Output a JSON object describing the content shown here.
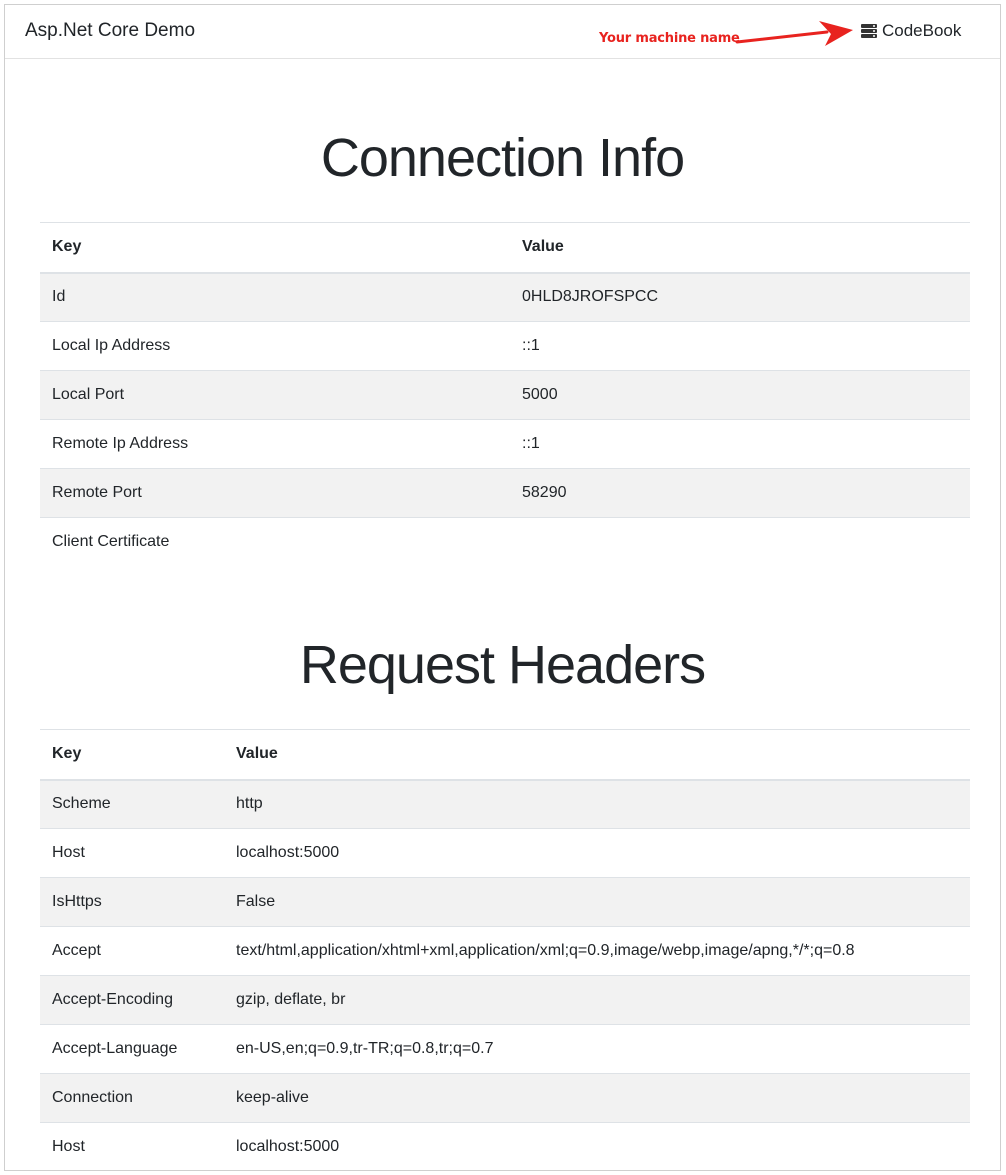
{
  "navbar": {
    "brand": "Asp.Net Core Demo",
    "machine_name": "CodeBook",
    "machine_icon": "server-icon",
    "annotation": "Your machine name",
    "annotation_color": "#e8231f"
  },
  "connection_info": {
    "title": "Connection Info",
    "columns": [
      "Key",
      "Value"
    ],
    "rows": [
      {
        "key": "Id",
        "value": "0HLD8JROFSPCC"
      },
      {
        "key": "Local Ip Address",
        "value": "::1"
      },
      {
        "key": "Local Port",
        "value": "5000"
      },
      {
        "key": "Remote Ip Address",
        "value": "::1"
      },
      {
        "key": "Remote Port",
        "value": "58290"
      },
      {
        "key": "Client Certificate",
        "value": ""
      }
    ]
  },
  "request_headers": {
    "title": "Request Headers",
    "columns": [
      "Key",
      "Value"
    ],
    "rows": [
      {
        "key": "Scheme",
        "value": "http"
      },
      {
        "key": "Host",
        "value": "localhost:5000"
      },
      {
        "key": "IsHttps",
        "value": "False"
      },
      {
        "key": "Accept",
        "value": "text/html,application/xhtml+xml,application/xml;q=0.9,image/webp,image/apng,*/*;q=0.8"
      },
      {
        "key": "Accept-Encoding",
        "value": "gzip, deflate, br"
      },
      {
        "key": "Accept-Language",
        "value": "en-US,en;q=0.9,tr-TR;q=0.8,tr;q=0.7"
      },
      {
        "key": "Connection",
        "value": "keep-alive"
      },
      {
        "key": "Host",
        "value": "localhost:5000"
      }
    ]
  }
}
